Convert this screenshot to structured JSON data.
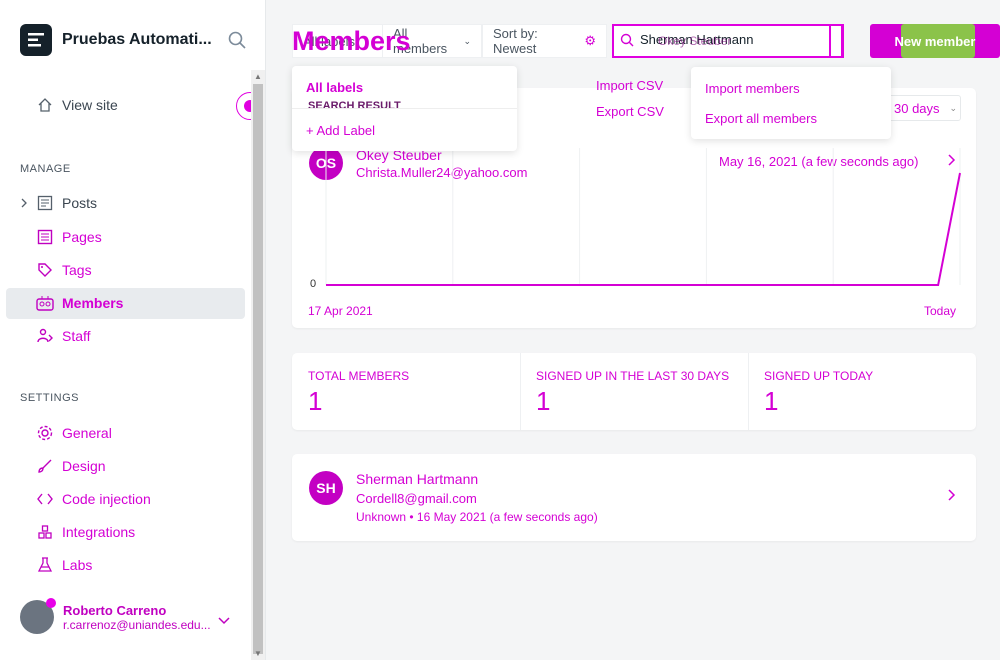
{
  "sidebar": {
    "brand": "Pruebas Automati...",
    "view_site": "View site",
    "manage_title": "MANAGE",
    "manage_items": [
      "Posts",
      "Pages",
      "Tags",
      "Members",
      "Staff"
    ],
    "settings_title": "SETTINGS",
    "settings_items": [
      "General",
      "Design",
      "Code injection",
      "Integrations",
      "Labs"
    ],
    "user": {
      "name": "Roberto Carreno",
      "email": "r.carrenoz@uniandes.edu..."
    }
  },
  "header": {
    "title": "Members",
    "filter_labels": "All labels",
    "filter_members": "All members",
    "sort": "Sort by: Newest",
    "search_value": "Sherman Hartmann",
    "search_overlay": "Okey Steuber",
    "new_member_label": "New member"
  },
  "labels_dropdown": {
    "all": "All labels",
    "search_result": "SEARCH RESULT",
    "add": "Add Label"
  },
  "actions": {
    "import_csv": "Import CSV",
    "export_csv": "Export CSV"
  },
  "actions_dropdown": {
    "import": "Import members",
    "export": "Export all members"
  },
  "period": "30 days",
  "chart_member": {
    "initials": "OS",
    "name": "Okey Steuber",
    "email": "Christa.Muller24@yahoo.com",
    "date": "May 16, 2021 (a few seconds ago)"
  },
  "chart_data": {
    "type": "line",
    "x": [
      "17 Apr 2021",
      "Today"
    ],
    "y_tick": "0",
    "series": [
      {
        "values": [
          0,
          0,
          0,
          0,
          0,
          0,
          0,
          0,
          0,
          0,
          0,
          0,
          0,
          0,
          0,
          0,
          0,
          0,
          0,
          0,
          0,
          0,
          0,
          0,
          0,
          0,
          0,
          0,
          0,
          1
        ]
      }
    ]
  },
  "stats": [
    {
      "label": "TOTAL MEMBERS",
      "value": "1"
    },
    {
      "label": "SIGNED UP IN THE LAST 30 DAYS",
      "value": "1"
    },
    {
      "label": "SIGNED UP TODAY",
      "value": "1"
    }
  ],
  "member": {
    "initials": "SH",
    "name": "Sherman Hartmann",
    "email": "Cordell8@gmail.com",
    "meta_source": "Unknown",
    "meta_date": "16 May 2021",
    "meta_ago": "(a few seconds ago)"
  },
  "colors": {
    "accent": "#d400d4",
    "green": "#8bc34a"
  }
}
